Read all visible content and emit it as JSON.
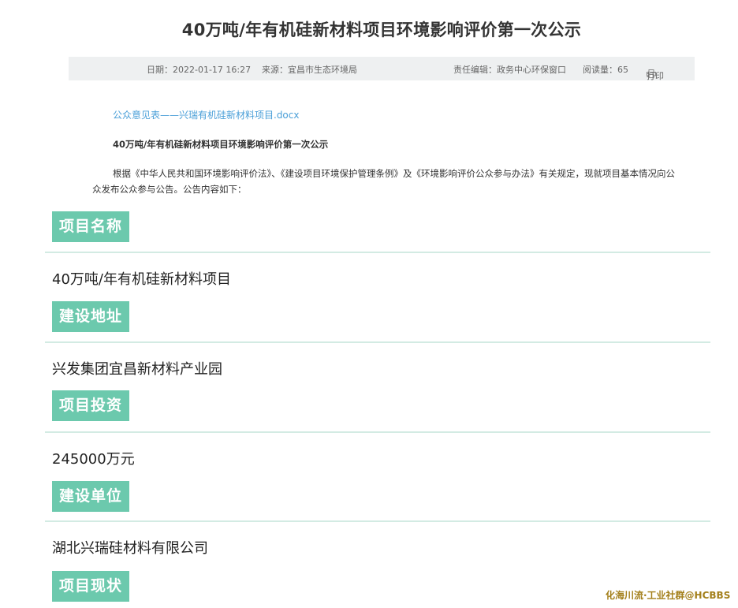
{
  "page": {
    "title": "40万吨/年有机硅新材料项目环境影响评价第一次公示"
  },
  "meta": {
    "date": "日期：2022-01-17 16:27",
    "source": "来源：宜昌市生态环境局",
    "editor": "责任编辑：政务中心环保窗口",
    "views": "阅读量：65",
    "print": "打印"
  },
  "attachment": {
    "link_text": "公众意见表——兴瑞有机硅新材料项目.docx"
  },
  "content": {
    "subtitle": "40万吨/年有机硅新材料项目环境影响评价第一次公示",
    "intro": "根据《中华人民共和国环境影响评价法》、《建设项目环境保护管理条例》及《环境影响评价公众参与办法》有关规定，现就项目基本情况向公众发布公众参与公告。公告内容如下："
  },
  "sections": [
    {
      "tag": "项目名称",
      "value": "40万吨/年有机硅新材料项目"
    },
    {
      "tag": "建设地址",
      "value": "兴发集团宜昌新材料产业园"
    },
    {
      "tag": "项目投资",
      "value": "245000万元"
    },
    {
      "tag": "建设单位",
      "value": "湖北兴瑞硅材料有限公司"
    },
    {
      "tag": "项目现状",
      "value": ""
    }
  ],
  "watermark": {
    "text": "化海川流·工业社群@HCBBS"
  },
  "colors": {
    "tag_bg": "#6cc9ad",
    "link": "#4a9fd8",
    "meta_bg": "#eef0f1",
    "divider": "#d3ebe3"
  }
}
